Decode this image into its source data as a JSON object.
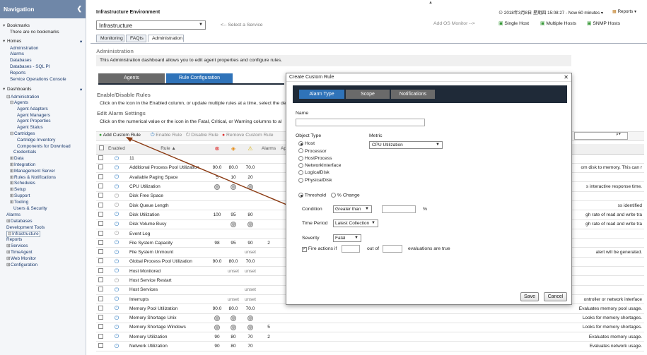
{
  "sidebar": {
    "title": "Navigation",
    "rows": [
      {
        "text": "Bookmarks",
        "toggle": "▾",
        "level": 0,
        "head": true
      },
      {
        "text": "There are no bookmarks",
        "toggle": "",
        "level": 2,
        "head": true
      },
      {
        "text": "Homes",
        "toggle": "▾",
        "level": 0,
        "head": true,
        "chev": "▾"
      },
      {
        "text": "Administration",
        "toggle": "",
        "level": 2
      },
      {
        "text": "Alarms",
        "toggle": "",
        "level": 2
      },
      {
        "text": "Databases",
        "toggle": "",
        "level": 2
      },
      {
        "text": "Databases - SQL PI",
        "toggle": "",
        "level": 2
      },
      {
        "text": "Reports",
        "toggle": "",
        "level": 2
      },
      {
        "text": "Service Operations Console",
        "toggle": "",
        "level": 2
      },
      {
        "text": "Dashboards",
        "toggle": "▾",
        "level": 0,
        "head": true,
        "chev": "▾"
      },
      {
        "text": "Administration",
        "toggle": "⊟",
        "level": 1
      },
      {
        "text": "Agents",
        "toggle": "⊟",
        "level": 2
      },
      {
        "text": "Agent Adapters",
        "toggle": "",
        "level": 4
      },
      {
        "text": "Agent Managers",
        "toggle": "",
        "level": 4
      },
      {
        "text": "Agent Properties",
        "toggle": "",
        "level": 4
      },
      {
        "text": "Agent Status",
        "toggle": "",
        "level": 4
      },
      {
        "text": "Cartridges",
        "toggle": "⊟",
        "level": 2
      },
      {
        "text": "Cartridge Inventory",
        "toggle": "",
        "level": 4
      },
      {
        "text": "Components for Download",
        "toggle": "",
        "level": 4
      },
      {
        "text": "Credentials",
        "toggle": "",
        "level": 3
      },
      {
        "text": "Data",
        "toggle": "⊞",
        "level": 2
      },
      {
        "text": "Integration",
        "toggle": "⊞",
        "level": 2
      },
      {
        "text": "Management Server",
        "toggle": "⊞",
        "level": 2
      },
      {
        "text": "Rules & Notifications",
        "toggle": "⊞",
        "level": 2
      },
      {
        "text": "Schedules",
        "toggle": "⊞",
        "level": 2
      },
      {
        "text": "Setup",
        "toggle": "⊞",
        "level": 2
      },
      {
        "text": "Support",
        "toggle": "⊞",
        "level": 2
      },
      {
        "text": "Tooling",
        "toggle": "⊞",
        "level": 2
      },
      {
        "text": "Users & Security",
        "toggle": "",
        "level": 3
      },
      {
        "text": "Alarms",
        "toggle": "",
        "level": 1
      },
      {
        "text": "Databases",
        "toggle": "⊞",
        "level": 1
      },
      {
        "text": "Development Tools",
        "toggle": "",
        "level": 1
      },
      {
        "text": "Infrastructure",
        "toggle": "⊟",
        "level": 1,
        "selected": true
      },
      {
        "text": "Reports",
        "toggle": "",
        "level": 1
      },
      {
        "text": "Services",
        "toggle": "⊞",
        "level": 1
      },
      {
        "text": "TimeAgent",
        "toggle": "⊞",
        "level": 1
      },
      {
        "text": "Web Monitor",
        "toggle": "⊞",
        "level": 1
      },
      {
        "text": "Configuration",
        "toggle": "⊞",
        "level": 1
      }
    ]
  },
  "header": {
    "env_label": "Infrastructure Environment",
    "env_value": "Infrastructure",
    "service_hint": "<-- Select a Service",
    "add_monitor": "Add OS Monitor -->",
    "datetime": "2018年3月8日 星期四 15:08:27 - Now 60 minutes",
    "reports": "Reports",
    "single_host": "Single Host",
    "multiple_hosts": "Multiple Hosts",
    "snmp_hosts": "SNMP Hosts",
    "tabs": [
      "Monitoring",
      "FAQts",
      "Administration"
    ]
  },
  "admin": {
    "title": "Administration",
    "description": "This Administration dashboard allows you to edit agent properties and configure rules.",
    "agents_tab": "Agents",
    "rule_tab": "Rule Configuration",
    "enable_title": "Enable/Disable Rules",
    "enable_text": "Click on the icon in the Enabled column, or update multiple rules at a time, select the de",
    "edit_title": "Edit Alarm Settings",
    "edit_text": "Click on the numerical value or the icon in the Fatal, Critical, or Warning columns to al"
  },
  "toolbar": {
    "add": "Add Custom Rule",
    "enable": "Enable Rule",
    "disable": "Disable Rule",
    "remove": "Remove Custom Rule"
  },
  "table": {
    "headers": [
      "Enabled",
      "Rule ▲",
      "",
      "",
      "",
      "Alarms",
      "Ap"
    ],
    "rows": [
      {
        "rule": "11",
        "f": "",
        "c": "",
        "w": "",
        "alarms": "",
        "desc": "",
        "off": false
      },
      {
        "rule": "Additional Process Pool Utilization",
        "f": "90.0",
        "c": "80.0",
        "w": "70.0",
        "alarms": "",
        "desc": "om disk to memory. This can r",
        "off": false
      },
      {
        "rule": "Available Paging Space",
        "f": "5",
        "c": "10",
        "w": "20",
        "alarms": "",
        "desc": "",
        "off": false
      },
      {
        "rule": "CPU Utilization",
        "f": "◎",
        "c": "◎",
        "w": "◎",
        "alarms": "",
        "desc": "s interactive response time.",
        "off": false
      },
      {
        "rule": "Disk Free Space",
        "f": "",
        "c": "",
        "w": "",
        "alarms": "",
        "desc": "",
        "off": true
      },
      {
        "rule": "Disk Queue Length",
        "f": "",
        "c": "",
        "w": "",
        "alarms": "",
        "desc": "ss identified",
        "off": true
      },
      {
        "rule": "Disk Utilization",
        "f": "100",
        "c": "95",
        "w": "80",
        "alarms": "",
        "desc": "gh rate of read and write tra",
        "off": false
      },
      {
        "rule": "Disk Volume Busy",
        "f": "",
        "c": "◎",
        "w": "◎",
        "alarms": "",
        "desc": "gh rate of read and write tra",
        "off": false
      },
      {
        "rule": "Event Log",
        "f": "",
        "c": "",
        "w": "",
        "alarms": "",
        "desc": "",
        "off": true
      },
      {
        "rule": "File System Capacity",
        "f": "98",
        "c": "95",
        "w": "90",
        "alarms": "2",
        "desc": "",
        "off": false
      },
      {
        "rule": "File System Unmount",
        "f": "",
        "c": "",
        "w": "unset",
        "alarms": "",
        "desc": "alert will be generated.",
        "off": false
      },
      {
        "rule": "Global Process Pool Utilization",
        "f": "90.0",
        "c": "80.0",
        "w": "70.0",
        "alarms": "",
        "desc": "",
        "off": false
      },
      {
        "rule": "Host Monitored",
        "f": "",
        "c": "unset",
        "w": "unset",
        "alarms": "",
        "desc": "",
        "off": false
      },
      {
        "rule": "Host Service Restart",
        "f": "",
        "c": "",
        "w": "",
        "alarms": "",
        "desc": "",
        "off": true
      },
      {
        "rule": "Host Services",
        "f": "",
        "c": "",
        "w": "unset",
        "alarms": "",
        "desc": "",
        "off": false
      },
      {
        "rule": "Interrupts",
        "f": "",
        "c": "unset",
        "w": "unset",
        "alarms": "",
        "desc": "ontroller or network interface",
        "off": false
      },
      {
        "rule": "Memory Pool Utilization",
        "f": "90.0",
        "c": "80.0",
        "w": "70.0",
        "alarms": "",
        "desc": "Evaluates memory pool usage.",
        "off": false
      },
      {
        "rule": "Memory Shortage Unix",
        "f": "◎",
        "c": "◎",
        "w": "◎",
        "alarms": "",
        "desc": "Looks for memory shortages.",
        "off": false
      },
      {
        "rule": "Memory Shortage Windows",
        "f": "◎",
        "c": "◎",
        "w": "◎",
        "alarms": "5",
        "desc": "Looks for memory shortages.",
        "off": false
      },
      {
        "rule": "Memory Utilization",
        "f": "90",
        "c": "80",
        "w": "70",
        "alarms": "2",
        "desc": "Evaluates memory usage.",
        "off": false
      },
      {
        "rule": "Network Utilization",
        "f": "90",
        "c": "80",
        "w": "70",
        "alarms": "",
        "desc": "Evaluates network usage.",
        "off": false
      }
    ]
  },
  "modal": {
    "title": "Create Custom Rule",
    "tabs": [
      "Alarm Type",
      "Scope",
      "Notifications"
    ],
    "name_label": "Name",
    "name_value": "",
    "object_type_label": "Object Type",
    "object_types": [
      "Host",
      "Processor",
      "HostProcess",
      "NetworkInterface",
      "LogicalDisk",
      "PhysicalDisk"
    ],
    "metric_label": "Metric",
    "metric_value": "CPU Utilization",
    "threshold_label": "Threshold",
    "pct_change_label": "% Change",
    "condition_label": "Condition",
    "condition_value": "Greater than",
    "condition_input": "",
    "percent": "%",
    "time_period_label": "Time Period",
    "time_period_value": "Latest Collection",
    "severity_label": "Severity",
    "severity_value": "Fatal",
    "fire_label": "Fire actions if",
    "fire_value": "",
    "out_of_label": "out of",
    "out_of_value": "",
    "evaluations_label": "evaluations are true",
    "save": "Save",
    "cancel": "Cancel"
  },
  "colors": {
    "nav_header": "#6f87a8",
    "dark_tab": "#1f2a38",
    "active_tab": "#2f73b9",
    "arrow": "#8b3a12"
  }
}
